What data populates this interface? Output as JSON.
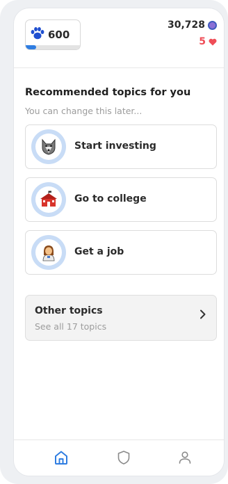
{
  "header": {
    "points_value": "600",
    "points_progress": 0.19,
    "coins_value": "30,728",
    "lives_value": "5",
    "accent_color": "#2f7de1",
    "heart_color": "#ef4d57"
  },
  "main": {
    "title": "Recommended topics for you",
    "subtitle": "You can change this later...",
    "topics": [
      {
        "label": "Start investing",
        "icon": "wolf-icon"
      },
      {
        "label": "Go to college",
        "icon": "school-icon"
      },
      {
        "label": "Get a job",
        "icon": "worker-icon"
      }
    ],
    "other": {
      "title": "Other topics",
      "subtitle": "See all 17 topics"
    }
  },
  "tabbar": {
    "items": [
      {
        "icon": "home-icon",
        "active": true
      },
      {
        "icon": "shield-icon",
        "active": false
      },
      {
        "icon": "profile-icon",
        "active": false
      }
    ]
  }
}
